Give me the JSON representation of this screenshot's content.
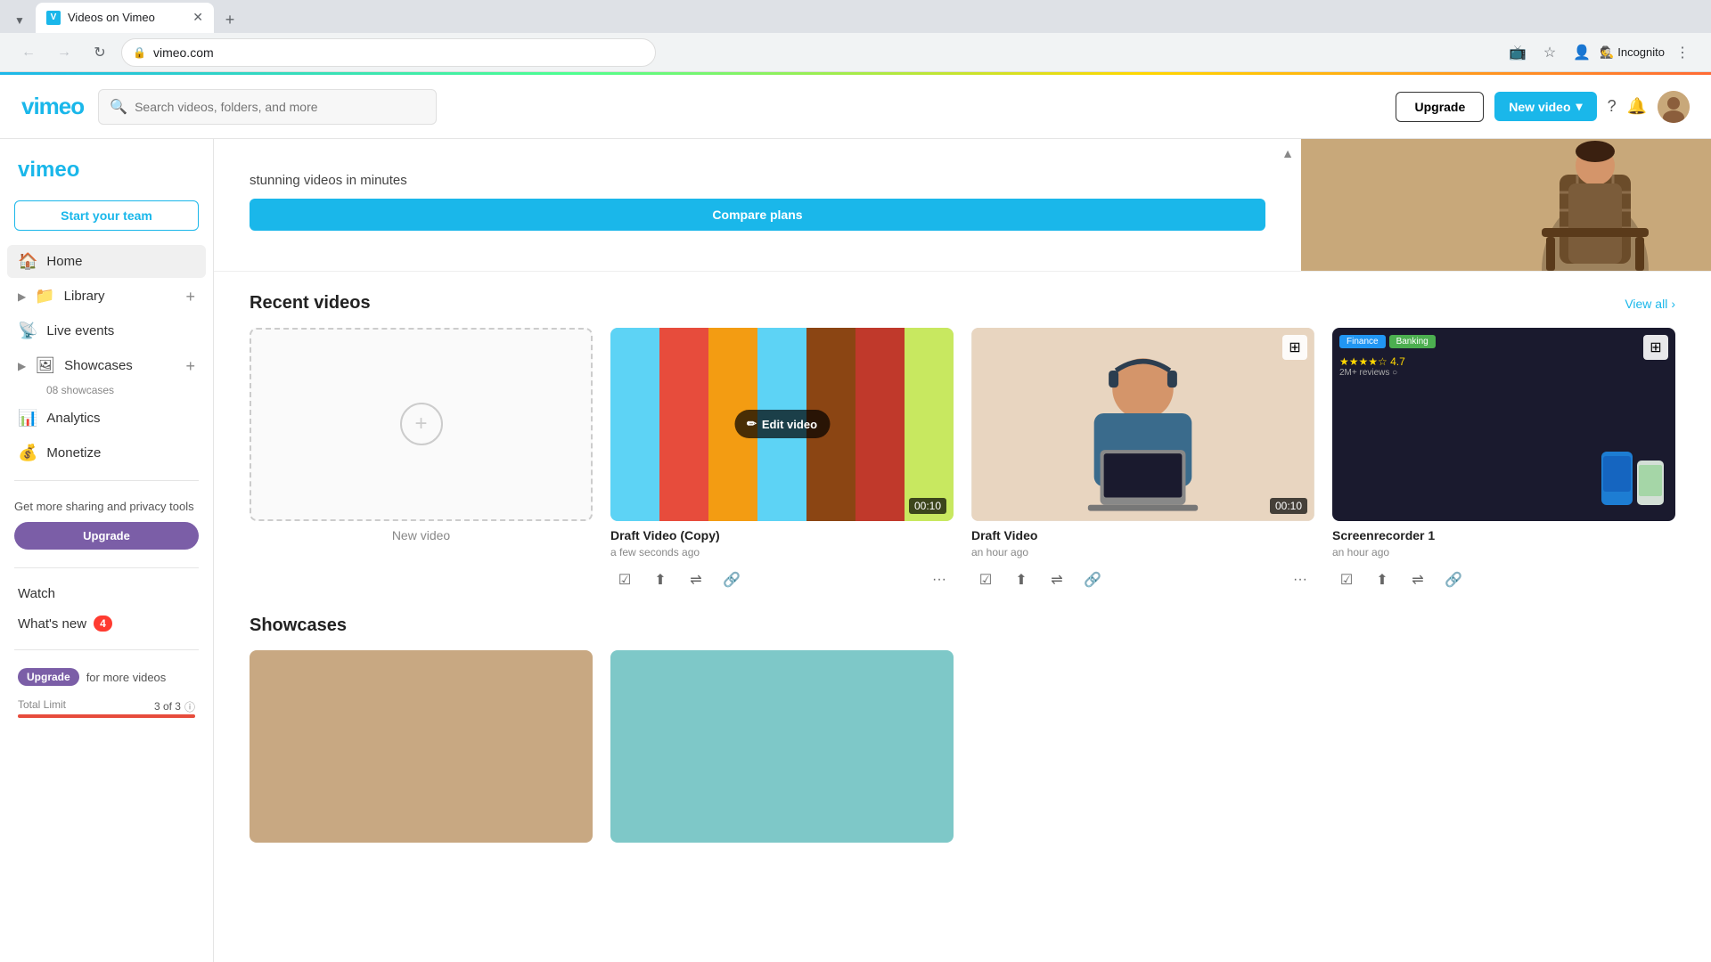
{
  "browser": {
    "tab_title": "Videos on Vimeo",
    "tab_favicon": "V",
    "address": "vimeo.com",
    "incognito_label": "Incognito"
  },
  "header": {
    "logo_text": "vimeo",
    "search_placeholder": "Search videos, folders, and more",
    "upgrade_btn": "Upgrade",
    "new_video_btn": "New video",
    "new_video_chevron": "▾"
  },
  "sidebar": {
    "team_btn": "Start your team",
    "nav_items": [
      {
        "label": "Home",
        "icon": "🏠"
      },
      {
        "label": "Library",
        "icon": "📁",
        "has_add": true,
        "has_chevron": true
      },
      {
        "label": "Live events",
        "icon": "📡"
      },
      {
        "label": "Showcases",
        "icon": "🖼",
        "has_add": true,
        "has_chevron": true,
        "count": "08 showcases"
      },
      {
        "label": "Analytics",
        "icon": "📊"
      },
      {
        "label": "Monetize",
        "icon": "💰"
      }
    ],
    "upgrade_prompt": "Get more sharing and privacy tools",
    "upgrade_btn": "Upgrade",
    "watch_label": "Watch",
    "whats_new_label": "What's new",
    "whats_new_badge": "4",
    "upgrade_inline_label": "Upgrade",
    "upgrade_inline_text": "for more videos",
    "total_limit_label": "Total Limit",
    "total_limit_value": "3 of 3",
    "total_limit_info": "ⓘ"
  },
  "promo": {
    "text": "stunning videos in minutes",
    "compare_btn": "Compare plans",
    "collapse_icon": "▲"
  },
  "recent_videos": {
    "section_title": "Recent videos",
    "view_all": "View all",
    "videos": [
      {
        "id": "new",
        "label": "New video",
        "is_new": true
      },
      {
        "id": "draft_copy",
        "title": "Draft Video (Copy)",
        "time": "a few seconds ago",
        "duration": "00:10",
        "has_edit_overlay": true,
        "thumb_type": "color_bars"
      },
      {
        "id": "draft",
        "title": "Draft Video",
        "time": "an hour ago",
        "duration": "00:10",
        "has_edit_overlay": false,
        "thumb_type": "person"
      },
      {
        "id": "screenrecorder",
        "title": "Screenrecorder 1",
        "time": "an hour ago",
        "duration": "",
        "has_edit_overlay": false,
        "thumb_type": "screen"
      }
    ],
    "action_icons": {
      "review": "☑",
      "upload": "⬆",
      "share": "⇌",
      "link": "🔗",
      "more": "···"
    }
  },
  "showcases": {
    "section_title": "Showcases",
    "cards": [
      {
        "id": 1,
        "bg": "#c8a882"
      },
      {
        "id": 2,
        "bg": "#7ec8c8"
      }
    ]
  }
}
